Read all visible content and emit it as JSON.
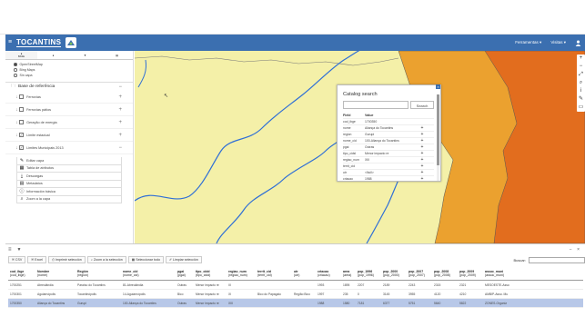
{
  "navbar": {
    "brand": "TOCANTINS",
    "menu_items": [
      "Ferramentas ▾",
      "Visitas ▾"
    ]
  },
  "sidebar": {
    "tabs": [
      {
        "icon": "circle-icon",
        "label": "BASE"
      },
      {
        "icon": "pin-icon",
        "label": ""
      },
      {
        "icon": "filter-icon",
        "label": ""
      },
      {
        "icon": "table-icon",
        "label": ""
      }
    ],
    "basemaps": [
      {
        "label": "OpenStreetMap",
        "selected": true
      },
      {
        "label": "Bing Maps",
        "selected": false
      },
      {
        "label": "Sin capa",
        "selected": false
      }
    ],
    "ref_header": "Base de referência",
    "layers": [
      {
        "label": "Ferrovias",
        "checked": false,
        "control": "+"
      },
      {
        "label": "Ferrovias pátios",
        "checked": false,
        "control": "+"
      },
      {
        "label": "Geração de energia",
        "checked": false,
        "control": "+"
      },
      {
        "label": "Limite estadual",
        "checked": true,
        "control": "+"
      },
      {
        "label": "Limites Municipais 2013",
        "checked": true,
        "control": "−"
      }
    ],
    "tools": [
      {
        "icon": "edit-icon",
        "label": "Editar capa"
      },
      {
        "icon": "table-icon",
        "label": "Tabla de atributos"
      },
      {
        "icon": "download-icon",
        "label": "Descargas"
      },
      {
        "icon": "metadata-icon",
        "label": "Metadatos"
      },
      {
        "icon": "info-icon",
        "label": "Información básica"
      },
      {
        "icon": "zoom-icon",
        "label": "Zoom a la capa"
      }
    ]
  },
  "catalog": {
    "title": "Catalog search",
    "search_button": "Search",
    "headers": [
      "Field",
      "Value"
    ],
    "rows": [
      {
        "field": "cod_ibge",
        "value": "1700350"
      },
      {
        "field": "nome",
        "value": "Aliança do Tocantins"
      },
      {
        "field": "region",
        "value": "Gurupi"
      },
      {
        "field": "nome_cid",
        "value": "100-Aliança do Tocantins"
      },
      {
        "field": "pgai",
        "value": "Outras"
      },
      {
        "field": "tipo_cidsl",
        "value": "Menor impacto re"
      },
      {
        "field": "regiao_num",
        "value": "XIII"
      },
      {
        "field": "territ_cid",
        "value": ""
      },
      {
        "field": "utr",
        "value": "<Null>"
      },
      {
        "field": "criacao",
        "value": "1988"
      }
    ]
  },
  "bottom": {
    "buttons": [
      "CSV",
      "Excel",
      "Imprimir selección",
      "Zoom a la selección",
      "Seleccionar todo",
      "Limpiar selección"
    ],
    "search_label": "Buscar:",
    "columns": [
      {
        "name": "cod_ibge",
        "sub": "(cod_ibge)"
      },
      {
        "name": "Nombre",
        "sub": "(nome)"
      },
      {
        "name": "Región",
        "sub": "(region)"
      },
      {
        "name": "nome_cid",
        "sub": "(nome_cid)"
      },
      {
        "name": "pgai",
        "sub": "(pgai)"
      },
      {
        "name": "tipo_cidd",
        "sub": "(tipo_cidd)"
      },
      {
        "name": "regiao_num",
        "sub": "(regiao_num)"
      },
      {
        "name": "territ_cid",
        "sub": "(territ_cid)"
      },
      {
        "name": "utr",
        "sub": "(utr)"
      },
      {
        "name": "criacao",
        "sub": "(criacao)"
      },
      {
        "name": "area",
        "sub": "(area)"
      },
      {
        "name": "pop_1996",
        "sub": "(pop_1996)"
      },
      {
        "name": "pop_2000",
        "sub": "(pop_2000)"
      },
      {
        "name": "pop_2007",
        "sub": "(pop_2007)"
      },
      {
        "name": "pop_2008",
        "sub": "(pop_2008)"
      },
      {
        "name": "pop_2009",
        "sub": "(pop_2009)"
      },
      {
        "name": "assoc_muni",
        "sub": "(assoc_muni)"
      }
    ],
    "rows": [
      {
        "selected": false,
        "cells": [
          "1700251",
          "Abreulândia",
          "Paraíso do Tocantins",
          "81-Abreulândia",
          "Outras",
          "Menor impacto re",
          "III",
          "",
          "",
          "1993",
          "1895",
          "2207",
          "2189",
          "2243",
          "2315",
          "2321",
          "MESOESTE-Asso"
        ]
      },
      {
        "selected": false,
        "cells": [
          "1700301",
          "Aguiarnópolis",
          "Tocantinópolis",
          "14-Aguiarnópolis",
          "Bico",
          "Menor impacto re",
          "XI",
          "Bico do Papagaio",
          "Região Bico",
          "1997",
          "235",
          "0",
          "3145",
          "3955",
          "4120",
          "4210",
          "AMBIP-Asso. Mu"
        ]
      },
      {
        "selected": true,
        "cells": [
          "1700350",
          "Aliança do Tocantins",
          "Gurupi",
          "100-Aliança do Tocantins",
          "Outras",
          "Menor impacto re",
          "XIII",
          "",
          "",
          "1988",
          "1580",
          "7181",
          "6377",
          "5751",
          "5640",
          "5822",
          "ZONES-Organiz"
        ]
      }
    ]
  },
  "colors": {
    "navbar": "#3b6fb0",
    "map_yellow": "#f4f0a8",
    "map_orange": "#ea9a2c",
    "map_dark_orange": "#e06d1d",
    "river": "#2f6fd6",
    "selected_row": "#b8c8e8"
  }
}
